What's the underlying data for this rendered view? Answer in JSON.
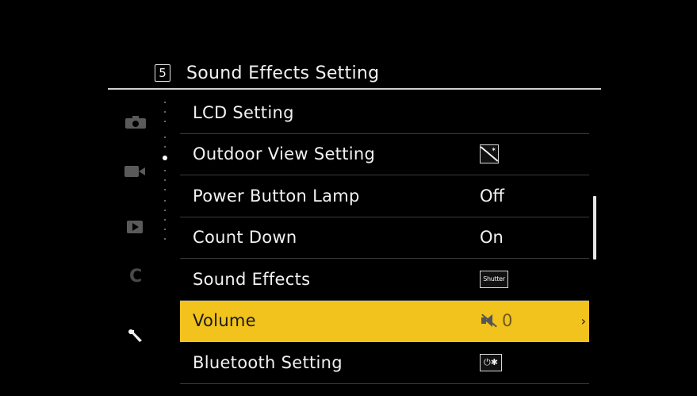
{
  "header": {
    "page_number": "5",
    "title": "Sound Effects Setting"
  },
  "side_modes": [
    "camera-icon",
    "video-icon",
    "playback-icon",
    "custom-icon",
    "wrench-icon"
  ],
  "items": [
    {
      "label": "LCD Setting",
      "value": ""
    },
    {
      "label": "Outdoor View Setting",
      "value_icon": "outdoor-view-icon"
    },
    {
      "label": "Power Button Lamp",
      "value": "Off"
    },
    {
      "label": "Count Down",
      "value": "On"
    },
    {
      "label": "Sound Effects",
      "value_badge": "Shutter"
    },
    {
      "label": "Volume",
      "value": "0",
      "value_icon": "mute-icon",
      "selected": true,
      "chevron": "›"
    },
    {
      "label": "Bluetooth Setting",
      "value_badge": "⏻✱"
    }
  ],
  "colors": {
    "highlight": "#f2c21d",
    "background": "#000000",
    "text": "#f2f2f2"
  }
}
